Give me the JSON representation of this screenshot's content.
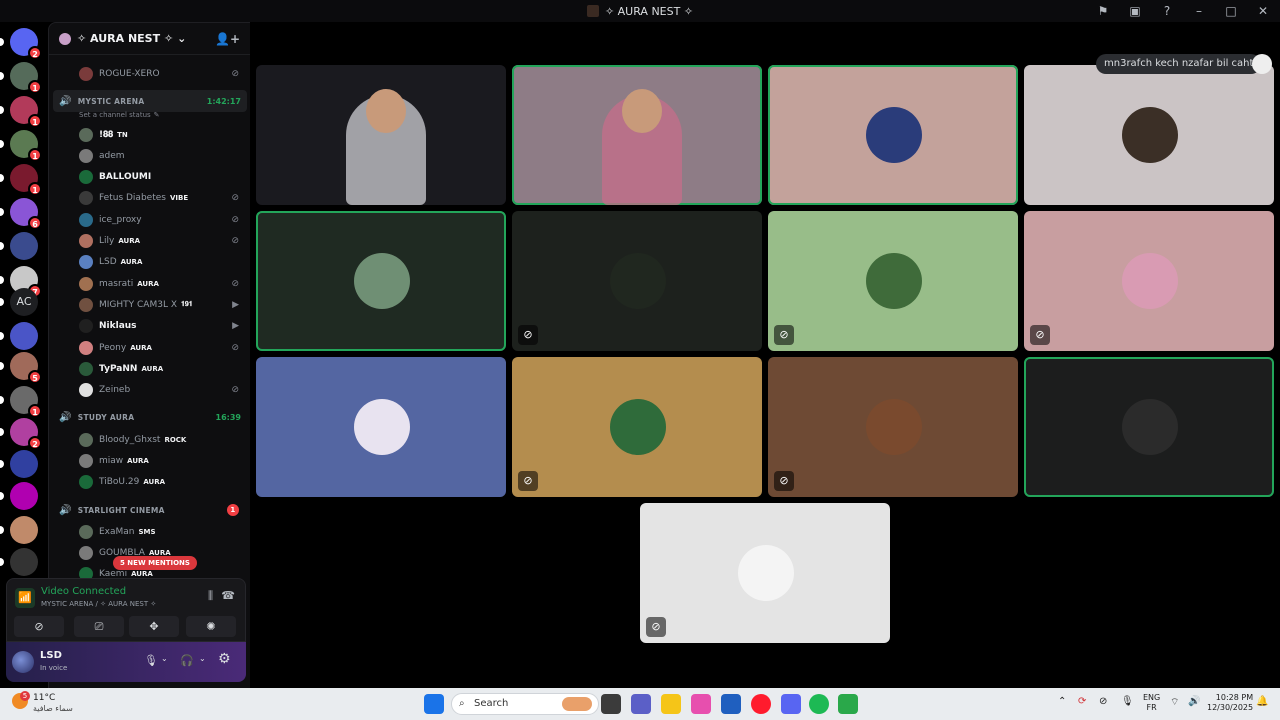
{
  "window": {
    "title": "✧ AURA NEST ✧"
  },
  "servers": [
    {
      "icon": "discord-logo-icon",
      "badge": "2"
    },
    {
      "icon": "server-avatar",
      "badge": "1"
    },
    {
      "icon": "server-avatar",
      "badge": "1"
    },
    {
      "icon": "server-avatar",
      "badge": "1"
    },
    {
      "icon": "server-avatar",
      "badge": "1"
    },
    {
      "icon": "server-avatar",
      "badge": "6"
    },
    {
      "icon": "server-avatar",
      "badge": ""
    },
    {
      "icon": "server-avatar",
      "badge": "7"
    },
    {
      "icon": "server-avatar",
      "badge": "",
      "label": "AC"
    },
    {
      "icon": "folder-icon",
      "badge": ""
    },
    {
      "icon": "server-avatar",
      "badge": "5"
    },
    {
      "icon": "server-avatar",
      "badge": "1"
    },
    {
      "icon": "server-avatar",
      "badge": "2"
    },
    {
      "icon": "server-avatar",
      "badge": ""
    },
    {
      "icon": "server-avatar",
      "badge": ""
    },
    {
      "icon": "server-avatar",
      "badge": ""
    },
    {
      "icon": "server-avatar",
      "badge": ""
    }
  ],
  "guild": {
    "name": "✧ AURA NEST ✧"
  },
  "channels": {
    "above_user": "ROGUE-XERO",
    "mystic": {
      "name": "MYSTIC ARENA",
      "time": "1:42:17",
      "status_placeholder": "Set a channel status"
    },
    "mystic_users": [
      {
        "name": "!𝟖𝟖",
        "tag": "TN",
        "bold": true
      },
      {
        "name": "adem",
        "tag": ""
      },
      {
        "name": "BALLOUMI",
        "tag": "",
        "bold": true
      },
      {
        "name": "Fetus Diabetes",
        "tag": "VIBE",
        "status": "deafened"
      },
      {
        "name": "ice_proxy",
        "tag": "",
        "status": "deafened"
      },
      {
        "name": "Lily",
        "tag": "AURA",
        "status": "deafened"
      },
      {
        "name": "LSD",
        "tag": "AURA"
      },
      {
        "name": "masrati",
        "tag": "AURA",
        "status": "deafened"
      },
      {
        "name": "MIGHTY CAM3L X",
        "tag": "𝟏𝟗𝟏",
        "status": "camera"
      },
      {
        "name": "Niklaus",
        "tag": "",
        "bold": true,
        "status": "camera"
      },
      {
        "name": "Peony",
        "tag": "AURA",
        "status": "deafened"
      },
      {
        "name": "TyPaNN",
        "tag": "AURA",
        "bold": true
      },
      {
        "name": "Zeineb",
        "tag": "",
        "status": "deafened"
      }
    ],
    "study": {
      "name": "STUDY AURA",
      "time": "16:39"
    },
    "study_users": [
      {
        "name": "Bloody_Ghxst",
        "tag": "ROCK"
      },
      {
        "name": "miaw",
        "tag": "AURA"
      },
      {
        "name": "TiBoU.29",
        "tag": "AURA"
      }
    ],
    "cinema": {
      "name": "STARLIGHT CINEMA",
      "badge": "1"
    },
    "cinema_users": [
      {
        "name": "ExaMan",
        "tag": "SMS"
      },
      {
        "name": "GOUMBLA",
        "tag": "AURA"
      },
      {
        "name": "Kaemi",
        "tag": "AURA"
      }
    ],
    "mentions": "5 NEW MENTIONS"
  },
  "voice_panel": {
    "title": "Video Connected",
    "subtitle": "MYSTIC ARENA / ✧ AURA NEST ✧"
  },
  "user": {
    "name": "LSD",
    "status": "In voice"
  },
  "tooltip": "mn3rafch kech nzafar bil caht",
  "tiles": [
    {
      "kind": "video",
      "bg": "#1a1a1f",
      "speaking": false,
      "muted": false
    },
    {
      "kind": "video",
      "bg": "#8e7c86",
      "speaking": true,
      "muted": false
    },
    {
      "kind": "avatar",
      "bg": "#c3a29b",
      "avatar": "#2a3c7a",
      "speaking": true,
      "muted": false
    },
    {
      "kind": "avatar",
      "bg": "#cbc4c5",
      "avatar": "#3b2f26",
      "speaking": false,
      "muted": false
    },
    {
      "kind": "avatar",
      "bg": "#1f2a22",
      "avatar": "#6f8f74",
      "speaking": true,
      "muted": false
    },
    {
      "kind": "avatar",
      "bg": "#1d211d",
      "avatar": "#20271f",
      "speaking": false,
      "muted": true
    },
    {
      "kind": "avatar",
      "bg": "#98bd89",
      "avatar": "#3f6b3a",
      "speaking": false,
      "muted": true
    },
    {
      "kind": "avatar",
      "bg": "#c89ea0",
      "avatar": "#d99bb3",
      "speaking": false,
      "muted": true
    },
    {
      "kind": "avatar",
      "bg": "#5466a2",
      "avatar": "#e8e3f0",
      "speaking": false,
      "muted": false
    },
    {
      "kind": "avatar",
      "bg": "#b48d4e",
      "avatar": "#2f6b3a",
      "speaking": false,
      "muted": true
    },
    {
      "kind": "avatar",
      "bg": "#6e4a34",
      "avatar": "#7a4a2e",
      "speaking": false,
      "muted": true
    },
    {
      "kind": "avatar",
      "bg": "#1c1d1d",
      "avatar": "#2b2b2b",
      "speaking": true,
      "muted": false
    },
    {
      "kind": "avatar",
      "bg": "#e4e4e4",
      "avatar": "#f4f4f4",
      "speaking": false,
      "muted": true
    }
  ],
  "taskbar": {
    "weather_badge": "5",
    "temp": "11°C",
    "condition": "سماء صافية",
    "search": "Search",
    "lang_top": "ENG",
    "lang_bottom": "FR",
    "time": "10:28 PM",
    "date": "12/30/2025"
  }
}
